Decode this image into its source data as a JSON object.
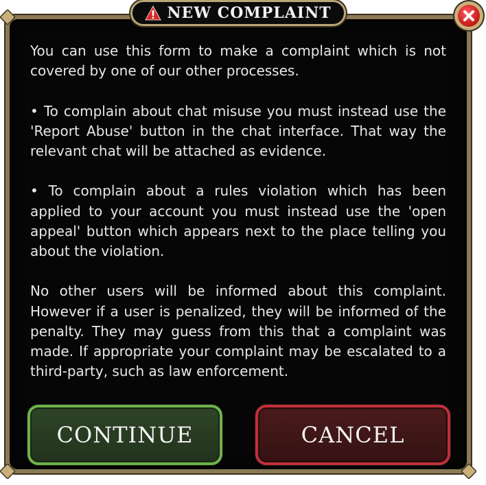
{
  "dialog": {
    "title": "NEW COMPLAINT",
    "paragraphs": [
      "You can use this form to make a complaint which is not covered by one of our other processes.",
      "• To complain about chat misuse you must instead use the 'Report Abuse' button in the chat interface. That way the relevant chat will be attached as evidence.",
      "• To complain about a rules violation which has been applied to your account you must instead use the 'open appeal' button which appears next to the place telling you about the violation.",
      "No other users will be informed about this complaint. However if a user is penalized, they will be informed of the penalty. They may guess from this that a complaint was made. If appropriate your complaint may be escalated to a third-party, such as law enforcement."
    ],
    "continue_label": "CONTINUE",
    "cancel_label": "CANCEL"
  },
  "icons": {
    "title_icon": "warning-icon",
    "close_icon": "close-icon"
  },
  "colors": {
    "panel_background": "#060606",
    "frame_gold": "#b9a677",
    "continue_border": "#6db24a",
    "cancel_border": "#c0303a",
    "warning_red": "#d42a2a",
    "close_red": "#c21818"
  }
}
